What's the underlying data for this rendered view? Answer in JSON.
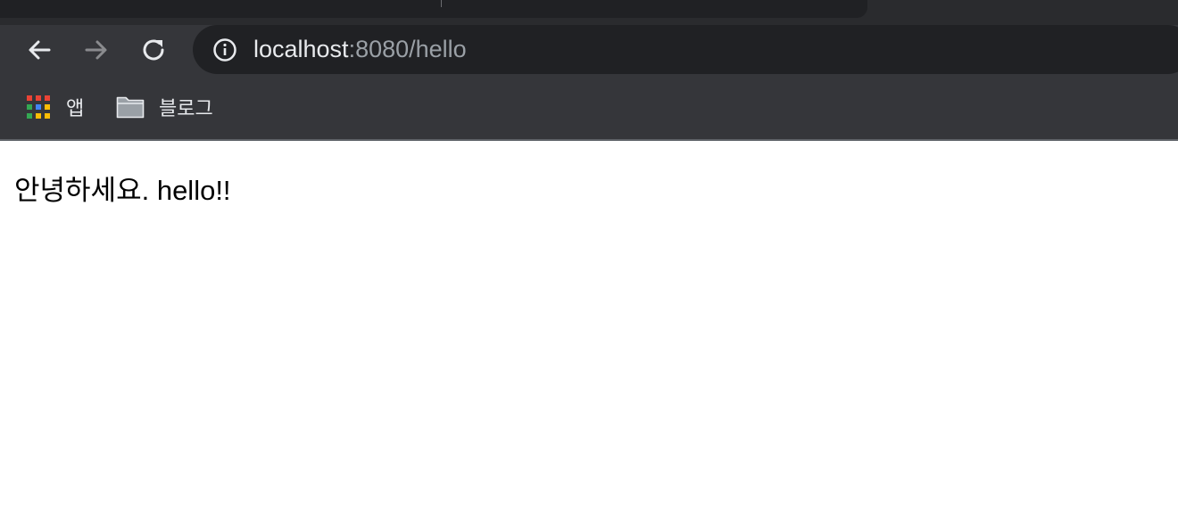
{
  "browser": {
    "url_host": "localhost",
    "url_rest": ":8080/hello"
  },
  "bookmarks": [
    {
      "label": "앱",
      "icon": "apps-grid-icon"
    },
    {
      "label": "블로그",
      "icon": "folder-icon"
    }
  ],
  "page": {
    "text": "안녕하세요. hello!!"
  },
  "colors": {
    "chrome_bg": "#35363a",
    "omnibox_bg": "#202124",
    "text_light": "#e8eaed",
    "text_dim": "#9aa0a6",
    "apps_grid": [
      "#ea4335",
      "#ea4335",
      "#ea4335",
      "#34a853",
      "#4285f4",
      "#fbbc05",
      "#34a853",
      "#fbbc05",
      "#fbbc05"
    ]
  }
}
